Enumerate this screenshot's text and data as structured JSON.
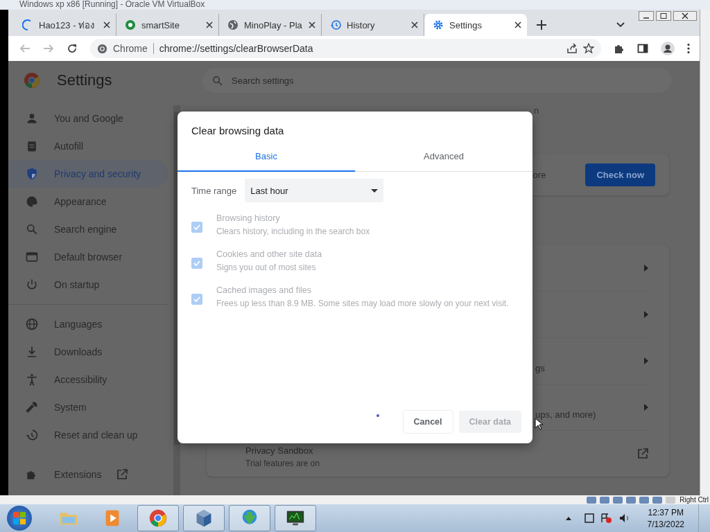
{
  "vm_window": {
    "title": "Windows xp x86 [Running] - Oracle VM VirtualBox",
    "host_key": "Right Ctrl"
  },
  "tabs": [
    {
      "title": "Hao123 - ท่อง",
      "selected": false
    },
    {
      "title": "smartSite",
      "selected": false
    },
    {
      "title": "MinoPlay - Pla",
      "selected": false
    },
    {
      "title": "History",
      "selected": false
    },
    {
      "title": "Settings",
      "selected": true
    }
  ],
  "address_bar": {
    "origin": "Chrome",
    "url": "chrome://settings/clearBrowserData"
  },
  "settings": {
    "title": "Settings",
    "search_placeholder": "Search settings",
    "nav": [
      {
        "label": "You and Google",
        "selected": false
      },
      {
        "label": "Autofill",
        "selected": false
      },
      {
        "label": "Privacy and security",
        "selected": true
      },
      {
        "label": "Appearance",
        "selected": false
      },
      {
        "label": "Search engine",
        "selected": false
      },
      {
        "label": "Default browser",
        "selected": false
      },
      {
        "label": "On startup",
        "selected": false
      },
      {
        "label": "Languages",
        "selected": false
      },
      {
        "label": "Downloads",
        "selected": false
      },
      {
        "label": "Accessibility",
        "selected": false
      },
      {
        "label": "System",
        "selected": false
      },
      {
        "label": "Reset and clean up",
        "selected": false
      },
      {
        "label": "Extensions",
        "selected": false
      }
    ],
    "heading_fragment": "n",
    "safety_check": {
      "text": "ore",
      "button": "Check now"
    },
    "rows": [
      {
        "kind": "link"
      },
      {
        "kind": "link"
      },
      {
        "kind": "link",
        "text": "gs"
      },
      {
        "kind": "link",
        "text": "ups, and more)"
      },
      {
        "kind": "external",
        "text": "Privacy Sandbox",
        "sub": "Trial features are on"
      }
    ]
  },
  "dialog": {
    "title": "Clear browsing data",
    "tabs": [
      {
        "label": "Basic",
        "selected": true
      },
      {
        "label": "Advanced",
        "selected": false
      }
    ],
    "time_range": {
      "label": "Time range",
      "value": "Last hour"
    },
    "options": [
      {
        "title": "Browsing history",
        "description": "Clears history, including in the search box",
        "checked": true
      },
      {
        "title": "Cookies and other site data",
        "description": "Signs you out of most sites",
        "checked": true
      },
      {
        "title": "Cached images and files",
        "description": "Frees up less than 8.9 MB. Some sites may load more slowly on your next visit.",
        "checked": true
      }
    ],
    "disabled": true,
    "buttons": {
      "cancel": "Cancel",
      "confirm": "Clear data"
    }
  },
  "taskbar": {
    "apps": [
      {
        "active": false
      },
      {
        "active": false
      },
      {
        "active": true
      },
      {
        "active": true
      },
      {
        "active": true
      },
      {
        "active": true
      }
    ],
    "time": "12:37 PM",
    "date": "7/13/2022"
  }
}
